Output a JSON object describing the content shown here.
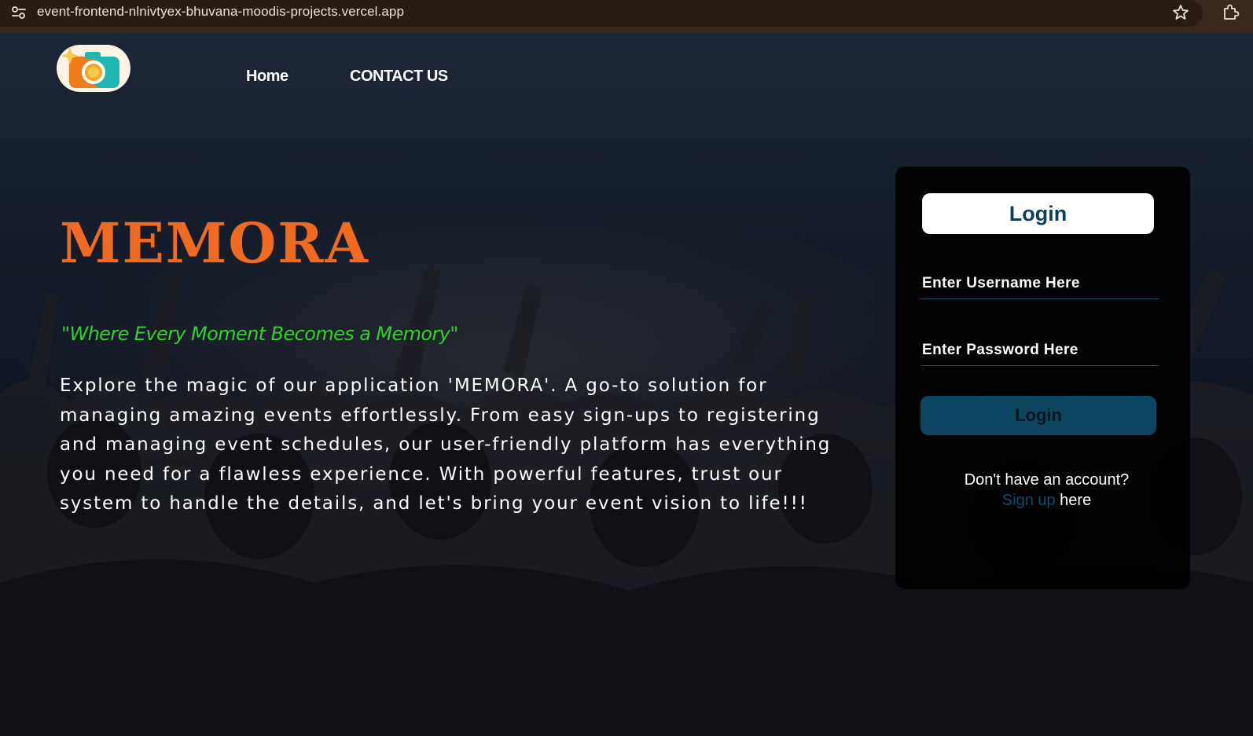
{
  "browser": {
    "url": "event-frontend-nlnivtyex-bhuvana-moodis-projects.vercel.app",
    "icons": [
      "site-info-icon",
      "bookmark-star-icon",
      "extensions-icon"
    ]
  },
  "nav": {
    "logo_icon": "camera-logo-icon",
    "items": [
      {
        "label": "Home"
      },
      {
        "label": "CONTACT US"
      }
    ]
  },
  "hero": {
    "title": "MEMORA",
    "tagline": "\"Where Every Moment Becomes a Memory\"",
    "description": "Explore the magic of our application 'MEMORA'. A go-to solution for managing amazing events effortlessly. From easy sign-ups to registering and managing event schedules, our user-friendly platform has everything you need for a flawless experience. With powerful features, trust our system to handle the details, and let's bring your event vision to life!!!"
  },
  "login": {
    "heading": "Login",
    "username_placeholder": "Enter Username Here",
    "password_placeholder": "Enter Password Here",
    "submit_label": "Login",
    "signup_prompt": "Don't have an account?",
    "signup_link": "Sign up",
    "signup_suffix": " here"
  },
  "colors": {
    "accent_title": "#f06a22",
    "tagline": "#33d12e",
    "login_primary": "#0d4661",
    "login_heading_text": "#0c3e5b",
    "card_background": "#000000"
  }
}
